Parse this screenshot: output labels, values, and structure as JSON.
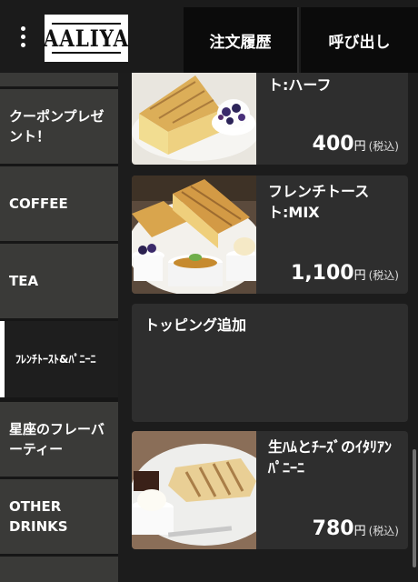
{
  "header": {
    "logo_text": "AALIYA",
    "orders_label": "注文履歴",
    "call_label": "呼び出し"
  },
  "sidebar": {
    "items": [
      {
        "label": ""
      },
      {
        "label": "クーポンプレゼント！"
      },
      {
        "label": "COFFEE"
      },
      {
        "label": "TEA"
      },
      {
        "label": "ﾌﾚﾝﾁﾄｰｽﾄ&ﾊﾟﾆｰﾆ",
        "active": true
      },
      {
        "label": "星座のフレーバーティー"
      },
      {
        "label": "OTHER DRINKS"
      }
    ]
  },
  "main": {
    "products": [
      {
        "name": "ト:ハーフ",
        "price": "400",
        "currency": "円",
        "tax": "(税込)"
      },
      {
        "name": "フレンチトースト:MIX",
        "price": "1,100",
        "currency": "円",
        "tax": "(税込)"
      },
      {
        "name": "生ﾊﾑとﾁｰｽﾞのｲﾀﾘｱﾝﾊﾟﾆｰﾆ",
        "price": "780",
        "currency": "円",
        "tax": "(税込)"
      }
    ],
    "section": {
      "title": "トッピング追加"
    }
  },
  "colors": {
    "header_bg": "#1b1b1b",
    "sidebar_item_bg": "#3a3a38",
    "card_bg": "#2e2e2e",
    "button_bg": "#0b0b0b"
  }
}
